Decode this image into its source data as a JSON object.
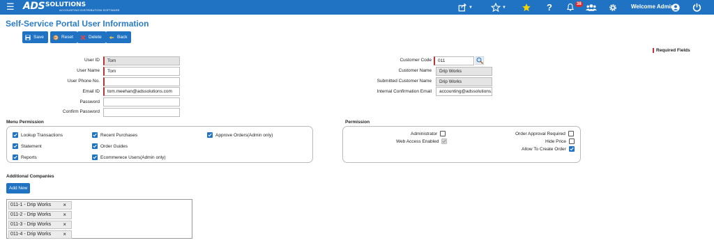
{
  "header": {
    "logo_main": "ADS",
    "logo_sub": "SOLUTIONS",
    "logo_tagline": "ACCOUNTING·DISTRIBUTION·SOFTWARE",
    "notification_count": "38",
    "welcome": "Welcome Admin",
    "icons": [
      "menu-icon",
      "share-icon",
      "star-outline-icon",
      "star-filled-icon",
      "help-icon",
      "bell-icon",
      "users-icon",
      "gear-icon",
      "user-circle-icon",
      "power-icon"
    ]
  },
  "page": {
    "title": "Self-Service Portal User Information",
    "required_note": "Required Fields"
  },
  "toolbar": {
    "save": "Save",
    "reset": "Reset",
    "delete": "Delete",
    "back": "Back"
  },
  "form_left": {
    "user_id": {
      "label": "User ID",
      "value": "Tom"
    },
    "user_name": {
      "label": "User Name",
      "value": "Tom"
    },
    "user_phone": {
      "label": "User Phone No.",
      "value": ""
    },
    "email_id": {
      "label": "Email ID",
      "value": "tom.meehan@adssolutions.com"
    },
    "password": {
      "label": "Password",
      "value": ""
    },
    "confirm_password": {
      "label": "Confirm Password",
      "value": ""
    }
  },
  "form_right": {
    "customer_code": {
      "label": "Customer Code",
      "value": "011"
    },
    "customer_name": {
      "label": "Customer Name",
      "value": "Drip Works"
    },
    "submitted_customer_name": {
      "label": "Submitted Customer Name",
      "value": "Drip Works"
    },
    "internal_email": {
      "label": "Internal Confirmation Email",
      "value": "accounting@adssolutions.c"
    }
  },
  "menu_permission": {
    "title": "Menu Permission",
    "items": [
      {
        "label": "Lookup Transactions",
        "checked": true
      },
      {
        "label": "Statement",
        "checked": true
      },
      {
        "label": "Reports",
        "checked": true
      },
      {
        "label": "Recent Purchases",
        "checked": true
      },
      {
        "label": "Order Guides",
        "checked": true
      },
      {
        "label": "Ecommerece Users(Admin only)",
        "checked": true
      },
      {
        "label": "Approve Orders(Admin only)",
        "checked": true
      }
    ]
  },
  "permission": {
    "title": "Permission",
    "administrator": {
      "label": "Administrator",
      "checked": false
    },
    "web_access": {
      "label": "Web Access Enabled",
      "checked": true,
      "disabled": true
    },
    "order_approval": {
      "label": "Order Approval Required",
      "checked": false
    },
    "hide_price": {
      "label": "Hide Price",
      "checked": false
    },
    "allow_create_order": {
      "label": "Allow To Create Order",
      "checked": true
    }
  },
  "additional_companies": {
    "title": "Additional Companies",
    "add_new": "Add New",
    "items": [
      "011-1 - Drip Works",
      "011-2 - Drip Works",
      "011-3 - Drip Works",
      "011-4 - Drip Works"
    ],
    "remove_glyph": "×"
  },
  "colors": {
    "brand": "#1f73c2",
    "title": "#2a7cc7",
    "required": "#b33333"
  }
}
